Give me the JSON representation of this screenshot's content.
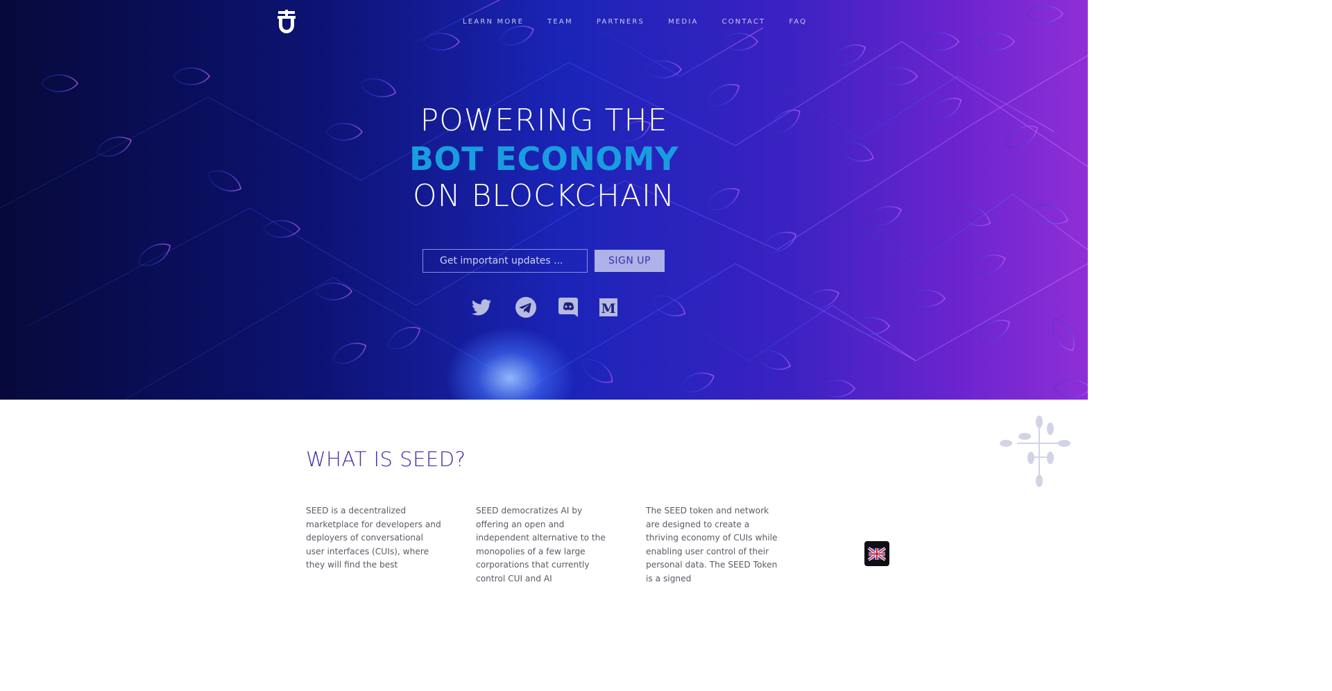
{
  "nav": {
    "items": [
      {
        "label": "LEARN MORE"
      },
      {
        "label": "TEAM"
      },
      {
        "label": "PARTNERS"
      },
      {
        "label": "MEDIA"
      },
      {
        "label": "CONTACT"
      },
      {
        "label": "FAQ"
      }
    ]
  },
  "hero": {
    "line1": "POWERING THE",
    "line2": "BOT ECONOMY",
    "line3": "ON BLOCKCHAIN",
    "email_placeholder": "Get important updates ...",
    "signup_label": "SIGN UP",
    "social": [
      "twitter-icon",
      "telegram-icon",
      "discord-icon",
      "medium-icon"
    ]
  },
  "about": {
    "title": "WHAT IS SEED?",
    "columns": [
      "SEED is a decentralized marketplace for developers and deployers of conversational user interfaces (CUIs), where they will find the best",
      "SEED democratizes AI by offering an open and independent alternative to the monopolies of a few large corporations that currently control CUI and AI",
      "The SEED token and network are designed to create a thriving economy of CUIs while enabling user control of their personal data. The SEED Token is a signed"
    ]
  },
  "language": {
    "icon": "uk-flag-icon"
  },
  "colors": {
    "accent_blue": "#1a9de0",
    "title_purple": "#3c2ea8",
    "signup_bg": "#aeb2e8"
  }
}
